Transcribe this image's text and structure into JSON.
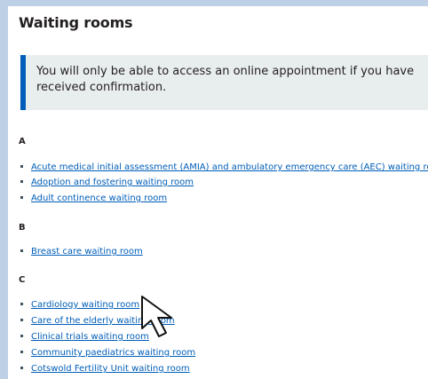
{
  "page": {
    "title": "Waiting rooms"
  },
  "notice": {
    "text": "You will only be able to access an online appointment if you have received confirmation."
  },
  "sections": [
    {
      "letter": "A",
      "items": [
        "Acute medical initial assessment (AMIA) and ambulatory emergency care (AEC) waiting room",
        "Adoption and fostering waiting room",
        "Adult continence waiting room"
      ]
    },
    {
      "letter": "B",
      "items": [
        "Breast care waiting room"
      ]
    },
    {
      "letter": "C",
      "items": [
        "Cardiology waiting room",
        "Care of the elderly waiting room",
        "Clinical trials waiting room",
        "Community paediatrics waiting room",
        "Cotswold Fertility Unit waiting room"
      ]
    }
  ],
  "colors": {
    "accent": "#005eb8",
    "background": "#bed0e6",
    "notice_bg": "#e8edee",
    "text": "#231f20"
  },
  "icons": {
    "cursor": "mouse-pointer-icon"
  }
}
